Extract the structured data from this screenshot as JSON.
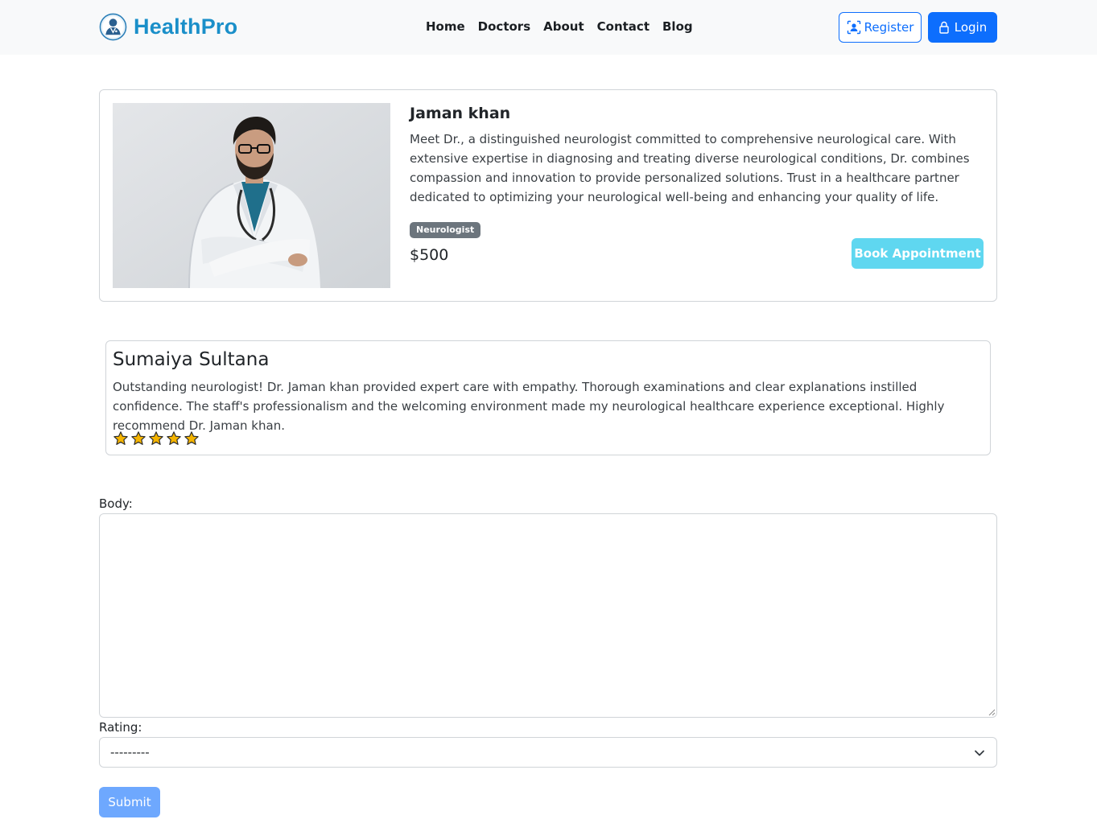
{
  "brand": {
    "name": "HealthPro",
    "logo_icon": "doctor-avatar-icon"
  },
  "nav": {
    "links": [
      "Home",
      "Doctors",
      "About",
      "Contact",
      "Blog"
    ],
    "register_label": "Register",
    "login_label": "Login"
  },
  "doctor": {
    "name": "Jaman khan",
    "bio": "Meet Dr., a distinguished neurologist committed to comprehensive neurological care. With extensive expertise in diagnosing and treating diverse neurological conditions, Dr. combines compassion and innovation to provide personalized solutions. Trust in a healthcare partner dedicated to optimizing your neurological well-being and enhancing your quality of life.",
    "specialty": "Neurologist",
    "fee": "$500",
    "book_label": "Book Appointment"
  },
  "review": {
    "reviewer": "Sumaiya Sultana",
    "body": "Outstanding neurologist! Dr. Jaman khan provided expert care with empathy. Thorough examinations and clear explanations instilled confidence. The staff's professionalism and the welcoming environment made my neurological healthcare experience exceptional. Highly recommend Dr. Jaman khan.",
    "rating": 5,
    "max_rating": 5
  },
  "form": {
    "body_label": "Body:",
    "body_value": "",
    "rating_label": "Rating:",
    "rating_selected": "---------",
    "submit_label": "Submit"
  },
  "colors": {
    "brand": "#1a8fc9",
    "primary": "#0d6efd",
    "info": "#5fd7f0",
    "badge": "#6c757d",
    "star": "#f5b400"
  }
}
